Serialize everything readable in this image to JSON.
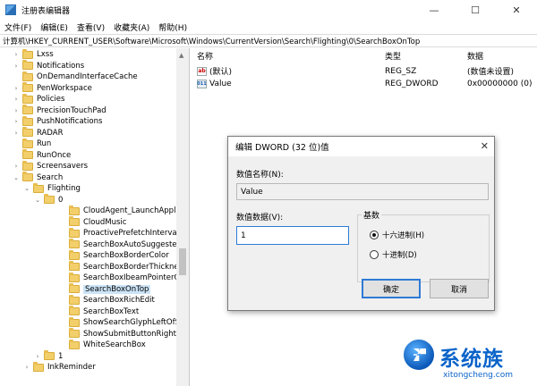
{
  "window": {
    "title": "注册表编辑器",
    "controls": {
      "minimize": "—",
      "maximize": "☐",
      "close": "✕"
    }
  },
  "menu": [
    "文件(F)",
    "编辑(E)",
    "查看(V)",
    "收藏夹(A)",
    "帮助(H)"
  ],
  "address": "计算机\\HKEY_CURRENT_USER\\Software\\Microsoft\\Windows\\CurrentVersion\\Search\\Flighting\\0\\SearchBoxOnTop",
  "tree": {
    "items": [
      {
        "label": "Lxss",
        "expander": ">"
      },
      {
        "label": "Notifications",
        "expander": ">"
      },
      {
        "label": "OnDemandInterfaceCache",
        "expander": ""
      },
      {
        "label": "PenWorkspace",
        "expander": ">"
      },
      {
        "label": "Policies",
        "expander": ">"
      },
      {
        "label": "PrecisionTouchPad",
        "expander": ">"
      },
      {
        "label": "PushNotifications",
        "expander": ">"
      },
      {
        "label": "RADAR",
        "expander": ">"
      },
      {
        "label": "Run",
        "expander": ""
      },
      {
        "label": "RunOnce",
        "expander": ""
      },
      {
        "label": "Screensavers",
        "expander": ">"
      },
      {
        "label": "Search",
        "expander": "v"
      },
      {
        "label": "Flighting",
        "expander": "v"
      },
      {
        "label": "0",
        "expander": "v"
      },
      {
        "label": "CloudAgent_LaunchApplicati",
        "expander": ""
      },
      {
        "label": "CloudMusic",
        "expander": ""
      },
      {
        "label": "ProactivePrefetchIntervalMin",
        "expander": ""
      },
      {
        "label": "SearchBoxAutoSuggestedFo",
        "expander": ""
      },
      {
        "label": "SearchBoxBorderColor",
        "expander": ""
      },
      {
        "label": "SearchBoxBorderThickness",
        "expander": ""
      },
      {
        "label": "SearchBoxIbeamPointerOnHi",
        "expander": ""
      },
      {
        "label": "SearchBoxOnTop",
        "expander": "",
        "selected": true
      },
      {
        "label": "SearchBoxRichEdit",
        "expander": ""
      },
      {
        "label": "SearchBoxText",
        "expander": ""
      },
      {
        "label": "ShowSearchGlyphLeftOfSear",
        "expander": ""
      },
      {
        "label": "ShowSubmitButtonRightOfSe",
        "expander": ""
      },
      {
        "label": "WhiteSearchBox",
        "expander": ""
      },
      {
        "label": "1",
        "expander": ">"
      },
      {
        "label": "InkReminder",
        "expander": ">"
      }
    ]
  },
  "values": {
    "headers": {
      "name": "名称",
      "type": "类型",
      "data": "数据"
    },
    "rows": [
      {
        "icon": "ab",
        "name": "(默认)",
        "type": "REG_SZ",
        "data": "(数值未设置)"
      },
      {
        "icon": "bin",
        "name": "Value",
        "type": "REG_DWORD",
        "data": "0x00000000 (0)"
      }
    ]
  },
  "dialog": {
    "title": "编辑 DWORD (32 位)值",
    "close": "✕",
    "name_label": "数值名称(N):",
    "name_value": "Value",
    "data_label": "数值数据(V):",
    "data_value": "1",
    "base_label": "基数",
    "hex_label": "十六进制(H)",
    "dec_label": "十进制(D)",
    "selected_base": "hex",
    "ok_label": "确定",
    "cancel_label": "取消"
  },
  "watermark": {
    "text": "系统族",
    "url": "xitongcheng.com"
  }
}
